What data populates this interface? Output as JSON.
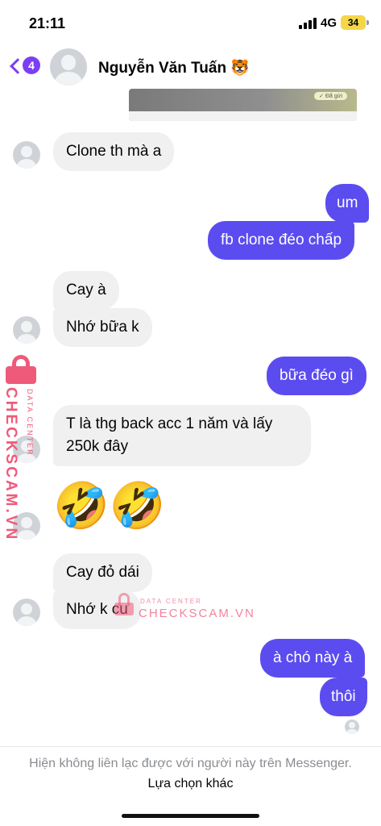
{
  "status_bar": {
    "time": "21:11",
    "network": "4G",
    "battery": "34"
  },
  "header": {
    "back_badge": "4",
    "contact_name": "Nguyễn Văn Tuấn 🐯"
  },
  "shared_preview": {
    "tag": "✓ Đã gửi"
  },
  "messages": [
    {
      "from": "them",
      "text": "Clone th mà a"
    },
    {
      "from": "me",
      "text": "um"
    },
    {
      "from": "me",
      "text": "fb clone đéo chấp"
    },
    {
      "from": "them",
      "text": "Cay à"
    },
    {
      "from": "them",
      "text": "Nhớ bữa k"
    },
    {
      "from": "me",
      "text": "bữa đéo gì"
    },
    {
      "from": "them",
      "text": "T là thg back acc 1 năm và lấy 250k đây"
    },
    {
      "from": "them",
      "text": "🤣🤣"
    },
    {
      "from": "them",
      "text": "Cay đỏ dái"
    },
    {
      "from": "them",
      "text": "Nhớ k cu"
    },
    {
      "from": "me",
      "text": "à chó này à"
    },
    {
      "from": "me",
      "text": "thôi"
    }
  ],
  "watermark": {
    "brand": "CHECKSCAM.VN",
    "sub": "DATA CENTER"
  },
  "footer": {
    "note": "Hiện không liên lạc được với người này trên Messenger.",
    "link": "Lựa chọn khác"
  },
  "colors": {
    "outgoing_bubble": "#5b4cf0",
    "incoming_bubble": "#f0f0f0",
    "accent": "#7b3ff2",
    "watermark": "#ef5a7a"
  }
}
